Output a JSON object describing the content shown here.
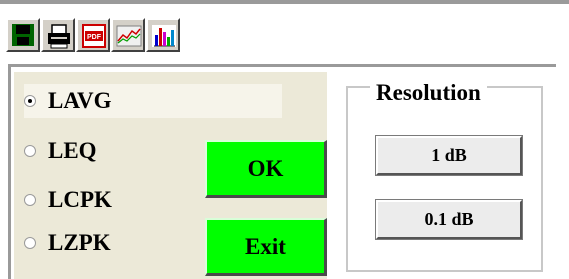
{
  "toolbar": {
    "buttons": [
      {
        "name": "save-icon"
      },
      {
        "name": "printer-icon"
      },
      {
        "name": "pdf-icon",
        "label": "PDF"
      },
      {
        "name": "line-chart-icon"
      },
      {
        "name": "bar-chart-icon"
      }
    ]
  },
  "modes": {
    "options": [
      {
        "label": "LAVG",
        "selected": true
      },
      {
        "label": "LEQ",
        "selected": false
      },
      {
        "label": "LCPK",
        "selected": false
      },
      {
        "label": "LZPK",
        "selected": false
      }
    ]
  },
  "actions": {
    "ok_label": "OK",
    "exit_label": "Exit"
  },
  "resolution": {
    "title": "Resolution",
    "options": [
      "1 dB",
      "0.1 dB"
    ]
  },
  "colors": {
    "action_button": "#00ff00",
    "panel_background": "#ece9d8",
    "toolbar_button": "#d4d0c8"
  }
}
